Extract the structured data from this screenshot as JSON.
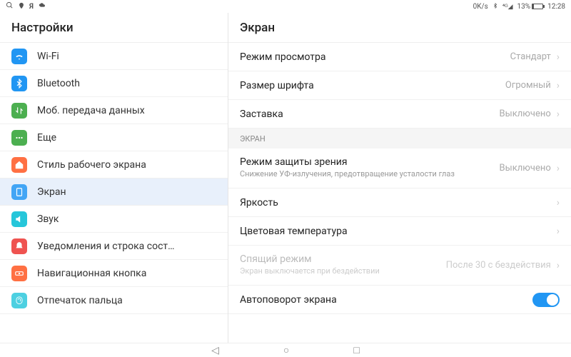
{
  "statusbar": {
    "speed": "0K/s",
    "battery_pct": "13%",
    "time": "12:28"
  },
  "sidebar": {
    "title": "Настройки",
    "items": [
      {
        "label": "Wi-Fi",
        "color": "#2196f3",
        "icon": "wifi"
      },
      {
        "label": "Bluetooth",
        "color": "#2196f3",
        "icon": "bt"
      },
      {
        "label": "Моб. передача данных",
        "color": "#4caf50",
        "icon": "data"
      },
      {
        "label": "Еще",
        "color": "#4caf50",
        "icon": "more"
      },
      {
        "label": "Стиль рабочего экрана",
        "color": "#ff7043",
        "icon": "home"
      },
      {
        "label": "Экран",
        "color": "#42a5f5",
        "icon": "screen"
      },
      {
        "label": "Звук",
        "color": "#26c6da",
        "icon": "sound"
      },
      {
        "label": "Уведомления и строка сост…",
        "color": "#ef5350",
        "icon": "notif"
      },
      {
        "label": "Навигационная кнопка",
        "color": "#ff7043",
        "icon": "nav"
      },
      {
        "label": "Отпечаток пальца",
        "color": "#4dd0e1",
        "icon": "finger"
      }
    ]
  },
  "main": {
    "title": "Экран",
    "rows": [
      {
        "title": "Режим просмотра",
        "value": "Стандарт"
      },
      {
        "title": "Размер шрифта",
        "value": "Огромный"
      },
      {
        "title": "Заставка",
        "value": "Выключено"
      }
    ],
    "section": "ЭКРАН",
    "eye": {
      "title": "Режим защиты зрения",
      "sub": "Снижение УФ-излучения, предотвращение усталости глаз",
      "value": "Выключено"
    },
    "brightness": {
      "title": "Яркость"
    },
    "colortemp": {
      "title": "Цветовая температура"
    },
    "sleep": {
      "title": "Спящий режим",
      "sub": "Экран выключается при бездействии",
      "value": "После 30 с бездействия"
    },
    "autorotate": {
      "title": "Автоповорот экрана"
    }
  }
}
